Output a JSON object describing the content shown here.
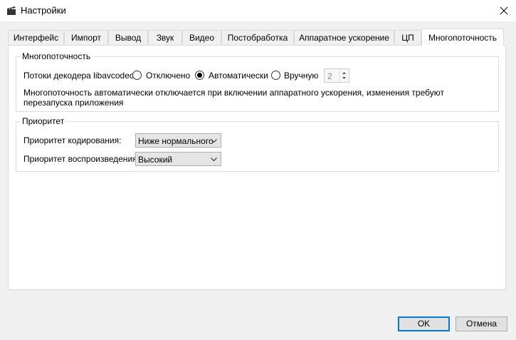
{
  "window": {
    "title": "Настройки"
  },
  "tabs": [
    {
      "label": "Интерфейс"
    },
    {
      "label": "Импорт"
    },
    {
      "label": "Вывод"
    },
    {
      "label": "Звук"
    },
    {
      "label": "Видео"
    },
    {
      "label": "Постобработка"
    },
    {
      "label": "Аппаратное ускорение"
    },
    {
      "label": "ЦП"
    },
    {
      "label": "Многопоточность",
      "active": true
    }
  ],
  "multithreading": {
    "group_title": "Многопоточность",
    "decoder_threads_label": "Потоки декодера libavcodec:",
    "options": [
      {
        "label": "Отключено",
        "checked": false
      },
      {
        "label": "Автоматически",
        "checked": true
      },
      {
        "label": "Вручную",
        "checked": false
      }
    ],
    "manual_value": "2",
    "note": "Многопоточность автоматически отключается при включении аппаратного ускорения, изменения требуют перезапуска приложения"
  },
  "priority": {
    "group_title": "Приоритет",
    "encoding_label": "Приоритет кодирования:",
    "encoding_value": "Ниже нормального",
    "playback_label": "Приоритет воспроизведения:",
    "playback_value": "Высокий"
  },
  "buttons": {
    "ok": "OK",
    "cancel": "Отмена"
  }
}
